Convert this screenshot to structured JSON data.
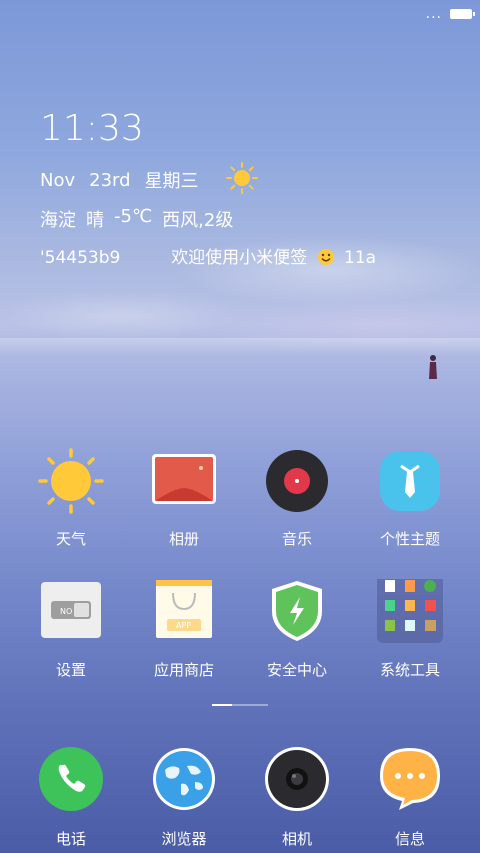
{
  "status": {
    "more": "...",
    "battery_level": 1.0
  },
  "widget": {
    "time": "11:33",
    "month": "Nov",
    "day": "23rd",
    "weekday": "星期三",
    "weather_icon": "sun-icon",
    "district": "海淀",
    "condition": "晴",
    "temperature": "-5℃",
    "wind": "西风,2级",
    "ticker_left": "'54453b9",
    "ticker_msg": "欢迎使用小米便签",
    "ticker_emoji": "smiley-icon",
    "ticker_right": "11a("
  },
  "apps_row1": [
    {
      "label": "天气",
      "icon": "weather-sun-icon"
    },
    {
      "label": "相册",
      "icon": "gallery-icon"
    },
    {
      "label": "音乐",
      "icon": "music-icon"
    },
    {
      "label": "个性主题",
      "icon": "themes-icon"
    }
  ],
  "apps_row2": [
    {
      "label": "设置",
      "icon": "settings-toggle-icon",
      "toggle_text": "NO"
    },
    {
      "label": "应用商店",
      "icon": "app-store-icon",
      "badge_text": "APP"
    },
    {
      "label": "安全中心",
      "icon": "security-shield-icon"
    },
    {
      "label": "系统工具",
      "icon": "system-tools-folder-icon"
    }
  ],
  "dock": [
    {
      "label": "电话",
      "icon": "phone-icon"
    },
    {
      "label": "浏览器",
      "icon": "browser-globe-icon"
    },
    {
      "label": "相机",
      "icon": "camera-icon"
    },
    {
      "label": "信息",
      "icon": "messages-icon"
    }
  ],
  "colors": {
    "sun": "#ffc93a",
    "phone_green": "#3ec25a",
    "shield_green": "#5fc25a",
    "message_orange": "#ffb347",
    "music_red": "#e2384c"
  }
}
